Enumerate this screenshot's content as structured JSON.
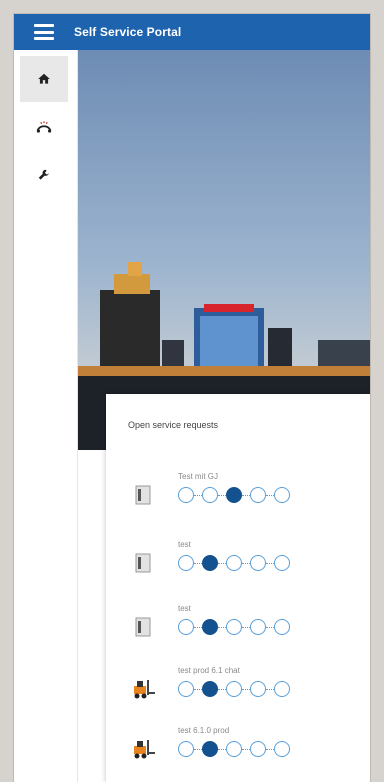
{
  "app": {
    "title": "Self Service Portal"
  },
  "sidebar": {
    "items": [
      {
        "icon": "home-icon",
        "active": true
      },
      {
        "icon": "helpdesk-icon",
        "active": false
      },
      {
        "icon": "wrench-icon",
        "active": false
      }
    ]
  },
  "panel": {
    "title": "Open service requests"
  },
  "requests": [
    {
      "name": "Test mit GJ",
      "icon": "document-icon",
      "current_step": 3
    },
    {
      "name": "test",
      "icon": "document-icon",
      "current_step": 2
    },
    {
      "name": "test",
      "icon": "document-icon",
      "current_step": 2
    },
    {
      "name": "test prod 6.1 chat",
      "icon": "forklift-icon",
      "current_step": 2
    },
    {
      "name": "test 6.1.0 prod",
      "icon": "forklift-icon",
      "current_step": 2
    }
  ],
  "steps": [
    "submitted-icon",
    "approval-icon",
    "processing-icon",
    "service-icon",
    "completed-flag-icon"
  ],
  "colors": {
    "appbar": "#1e63ad",
    "step_current": "#14528f",
    "step_outline": "#5a9fd6"
  }
}
